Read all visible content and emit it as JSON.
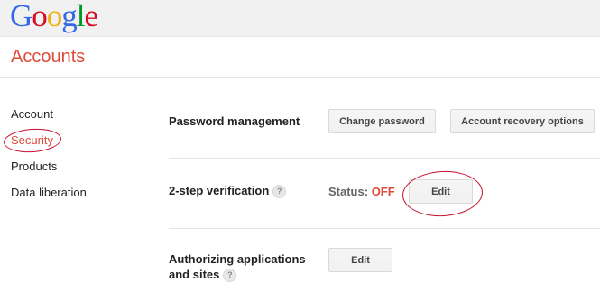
{
  "brand": {
    "logo_letters": [
      {
        "ch": "G",
        "color": "#3369e8"
      },
      {
        "ch": "o",
        "color": "#d50f25"
      },
      {
        "ch": "o",
        "color": "#eeb211"
      },
      {
        "ch": "g",
        "color": "#3369e8"
      },
      {
        "ch": "l",
        "color": "#009925"
      },
      {
        "ch": "e",
        "color": "#d50f25"
      }
    ],
    "page_title": "Accounts"
  },
  "sidebar": {
    "items": [
      {
        "label": "Account"
      },
      {
        "label": "Security",
        "active": true
      },
      {
        "label": "Products"
      },
      {
        "label": "Data liberation"
      }
    ]
  },
  "sections": {
    "password": {
      "label": "Password management",
      "change_button": "Change password",
      "recovery_button": "Account recovery options"
    },
    "two_step": {
      "label": "2-step verification",
      "help": "?",
      "status_label": "Status:",
      "status_value": "OFF",
      "edit_button": "Edit"
    },
    "authorizing": {
      "label_line1": "Authorizing applications",
      "label_line2": "and sites",
      "help": "?",
      "edit_button": "Edit"
    }
  },
  "colors": {
    "accent_red": "#dd4b39",
    "annotation_red": "#c8102e"
  }
}
